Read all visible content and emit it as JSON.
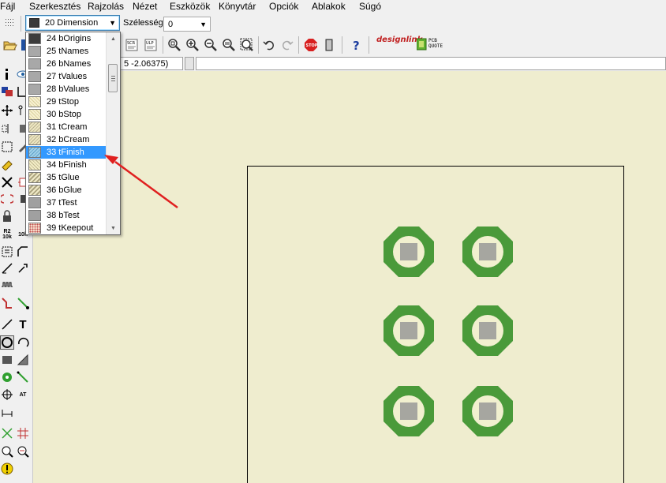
{
  "menu": [
    "Fájl",
    "Szerkesztés",
    "Rajzolás",
    "Nézet",
    "Eszközök",
    "Könyvtár",
    "Opciók",
    "Ablakok",
    "Súgó"
  ],
  "layer_select": {
    "value": "20 Dimension"
  },
  "width": {
    "label": "Szélesség:",
    "value": "0"
  },
  "coordinates": "5 -2.06375)",
  "toolbar": {
    "designlink": "designlink",
    "pcb_quote_1": "PCB",
    "pcb_quote_2": "QUOTE"
  },
  "layers": [
    {
      "label": "24 bOrigins",
      "swatch": "dark"
    },
    {
      "label": "25 tNames",
      "swatch": "gray"
    },
    {
      "label": "26 bNames",
      "swatch": "gray"
    },
    {
      "label": "27 tValues",
      "swatch": "gray"
    },
    {
      "label": "28 bValues",
      "swatch": "gray"
    },
    {
      "label": "29 tStop",
      "swatch": "stop"
    },
    {
      "label": "30 bStop",
      "swatch": "stop"
    },
    {
      "label": "31 tCream",
      "swatch": "cream"
    },
    {
      "label": "32 bCream",
      "swatch": "cream"
    },
    {
      "label": "33 tFinish",
      "swatch": "finish",
      "selected": true
    },
    {
      "label": "34 bFinish",
      "swatch": "bfinish"
    },
    {
      "label": "35 tGlue",
      "swatch": "glue"
    },
    {
      "label": "36 bGlue",
      "swatch": "glue"
    },
    {
      "label": "37 tTest",
      "swatch": "test"
    },
    {
      "label": "38 bTest",
      "swatch": "test"
    },
    {
      "label": "39 tKeepout",
      "swatch": "keep"
    }
  ],
  "left_tool_text": {
    "r2": "R2",
    "ten_k": "10k",
    "t": "T",
    "at": "AT"
  },
  "colors": {
    "pad_ring": "#4a9a3a",
    "pad_inner": "#f1f0cf",
    "pad_drill": "#a6a6a0",
    "canvas": "#efedcf",
    "arrow": "#e02020",
    "selection": "#3399ff"
  }
}
